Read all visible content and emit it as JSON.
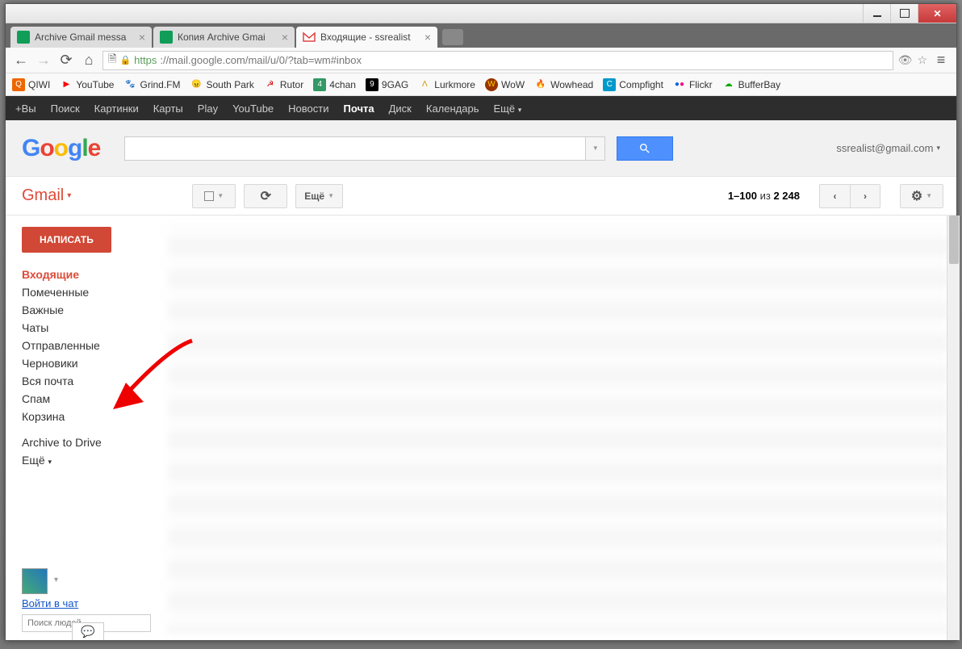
{
  "tabs": [
    {
      "title": "Archive Gmail messa",
      "active": false
    },
    {
      "title": "Копия Archive Gmai",
      "active": false
    },
    {
      "title": "Входящие - ssrealist",
      "active": true
    }
  ],
  "url": {
    "proto": "https",
    "host": "://mail.google.com",
    "path": "/mail/u/0/?tab=wm#inbox"
  },
  "bookmarks": [
    "QIWI",
    "YouTube",
    "Grind.FM",
    "South Park",
    "Rutor",
    "4chan",
    "9GAG",
    "Lurkmore",
    "WoW",
    "Wowhead",
    "Compfight",
    "Flickr",
    "BufferBay"
  ],
  "google_nav": [
    "+Вы",
    "Поиск",
    "Картинки",
    "Карты",
    "Play",
    "YouTube",
    "Новости",
    "Почта",
    "Диск",
    "Календарь",
    "Ещё"
  ],
  "google_nav_active": "Почта",
  "user_email": "ssrealist@gmail.com",
  "gmail_label": "Gmail",
  "toolbar": {
    "more": "Ещё",
    "page_range": "1–100",
    "page_of": "из",
    "page_total": "2 248"
  },
  "compose": "НАПИСАТЬ",
  "folders": [
    {
      "label": "Входящие",
      "active": true
    },
    {
      "label": "Помеченные"
    },
    {
      "label": "Важные"
    },
    {
      "label": "Чаты"
    },
    {
      "label": "Отправленные"
    },
    {
      "label": "Черновики"
    },
    {
      "label": "Вся почта"
    },
    {
      "label": "Спам"
    },
    {
      "label": "Корзина"
    },
    {
      "label": "Archive to Drive",
      "sep": true
    },
    {
      "label": "Ещё",
      "caret": true
    }
  ],
  "chat": {
    "signin": "Войти в чат",
    "search_placeholder": "Поиск людей..."
  }
}
